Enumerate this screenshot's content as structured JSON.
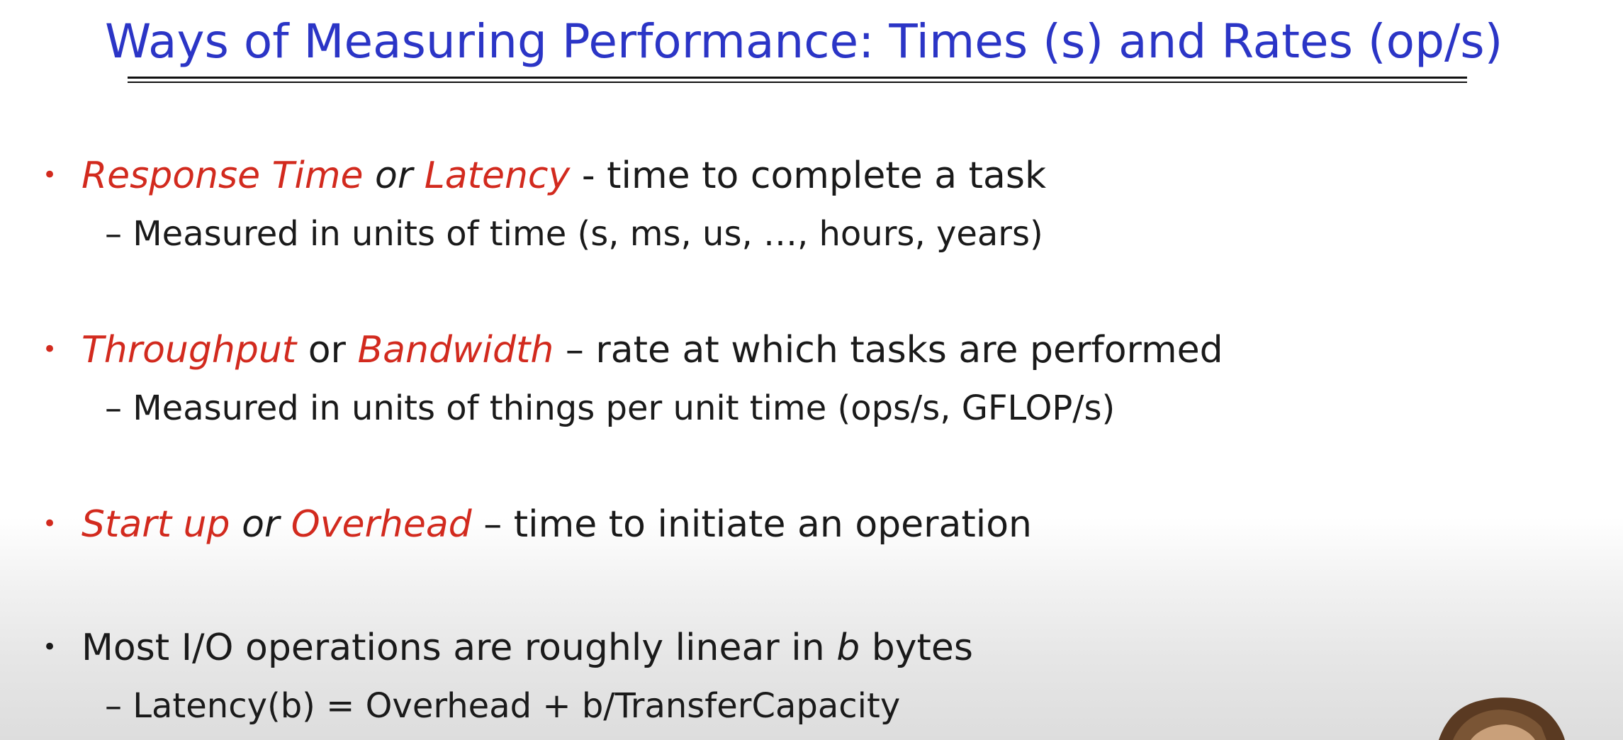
{
  "slide": {
    "title": "Ways of Measuring Performance: Times (s) and Rates (op/s)",
    "bullets": [
      {
        "term1": "Response Time",
        "connector": "or",
        "term2": "Latency",
        "rest": "- time to complete a task",
        "sub": "– Measured in units of time (s, ms, us, …, hours, years)"
      },
      {
        "term1": "Throughput",
        "connector": "or",
        "term2": "Bandwidth",
        "rest": "– rate at which tasks are performed",
        "sub": "– Measured in units of things per unit time (ops/s, GFLOP/s)"
      },
      {
        "term1": "Start up",
        "connector": "or",
        "term2": "Overhead",
        "rest": "– time to initiate an operation"
      },
      {
        "pre": "Most I/O operations are roughly linear in",
        "var": "b",
        "rest": "bytes",
        "sub": "– Latency(b) = Overhead + b/TransferCapacity"
      }
    ]
  },
  "colors": {
    "title": "#2b35c6",
    "emphasis": "#d22a1e",
    "text": "#1a1a1a"
  }
}
